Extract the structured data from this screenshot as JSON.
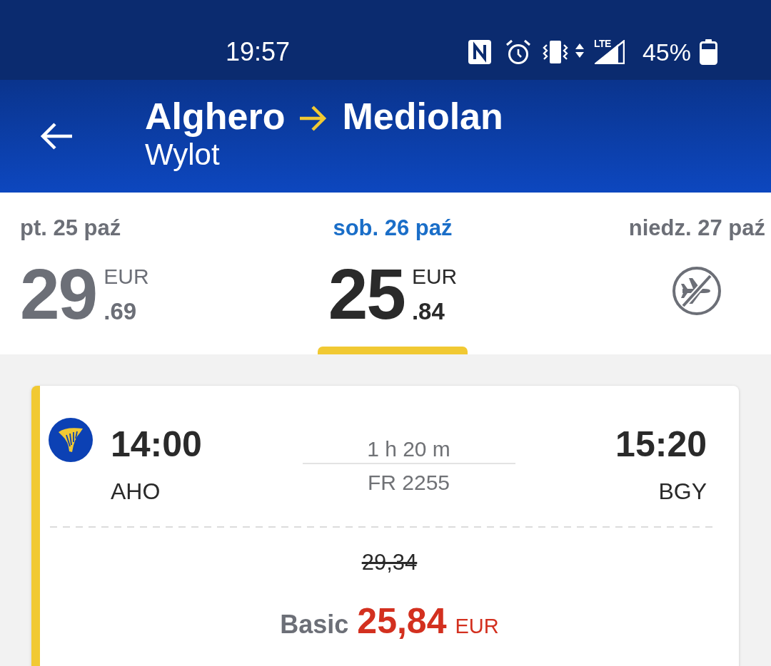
{
  "status_bar": {
    "time": "19:57",
    "network": "LTE",
    "battery": "45%"
  },
  "header": {
    "origin": "Alghero",
    "destination": "Mediolan",
    "subtitle": "Wylot"
  },
  "dates": [
    {
      "label": "pt. 25 paź",
      "kind": "fare",
      "selected": false,
      "amount": "29",
      "currency": "EUR",
      "cents": ".69"
    },
    {
      "label": "sob. 26 paź",
      "kind": "fare",
      "selected": true,
      "amount": "25",
      "currency": "EUR",
      "cents": ".84"
    },
    {
      "label": "niedz. 27 paź",
      "kind": "no_flights",
      "selected": false
    }
  ],
  "flights": [
    {
      "departure_time": "14:00",
      "departure_airport": "AHO",
      "duration": "1 h 20 m",
      "flight_number": "FR 2255",
      "arrival_time": "15:20",
      "arrival_airport": "BGY",
      "old_price": "29,34",
      "fare": "Basic",
      "price": "25,84",
      "currency": "EUR"
    }
  ]
}
